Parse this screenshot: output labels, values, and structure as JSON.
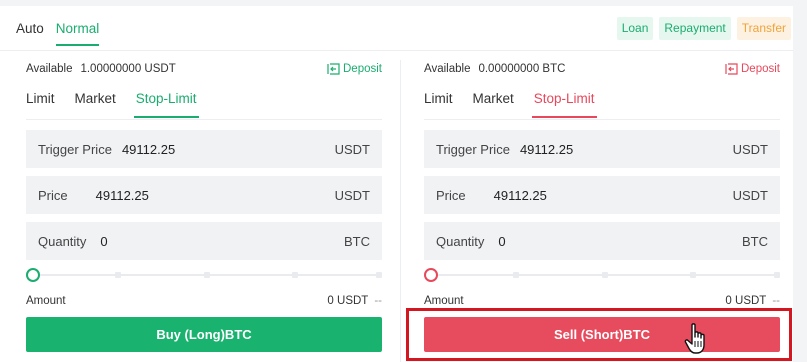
{
  "mode_tabs": {
    "auto": "Auto",
    "normal": "Normal"
  },
  "header_buttons": {
    "loan": "Loan",
    "repayment": "Repayment",
    "transfer": "Transfer"
  },
  "buy": {
    "available_label": "Available",
    "available_value": "1.00000000 USDT",
    "deposit": "Deposit",
    "tabs": [
      "Limit",
      "Market",
      "Stop-Limit"
    ],
    "active_tab": "Stop-Limit",
    "trigger_price_label": "Trigger Price",
    "trigger_price_value": "49112.25",
    "trigger_price_unit": "USDT",
    "price_label": "Price",
    "price_value": "49112.25",
    "price_unit": "USDT",
    "quantity_label": "Quantity",
    "quantity_value": "0",
    "quantity_unit": "BTC",
    "slider_percent": 0,
    "amount_label": "Amount",
    "amount_value": "0 USDT",
    "amount_extra": "--",
    "button": "Buy (Long)BTC",
    "color": "#1aad6f"
  },
  "sell": {
    "available_label": "Available",
    "available_value": "0.00000000 BTC",
    "deposit": "Deposit",
    "tabs": [
      "Limit",
      "Market",
      "Stop-Limit"
    ],
    "active_tab": "Stop-Limit",
    "trigger_price_label": "Trigger Price",
    "trigger_price_value": "49112.25",
    "trigger_price_unit": "USDT",
    "price_label": "Price",
    "price_value": "49112.25",
    "price_unit": "USDT",
    "quantity_label": "Quantity",
    "quantity_value": "0",
    "quantity_unit": "BTC",
    "slider_percent": 0,
    "amount_label": "Amount",
    "amount_value": "0 USDT",
    "amount_extra": "--",
    "button": "Sell (Short)BTC",
    "color": "#e8485b"
  },
  "highlight_color": "#d41620",
  "icons": [
    "deposit-icon",
    "hand-pointer-cursor-icon"
  ]
}
